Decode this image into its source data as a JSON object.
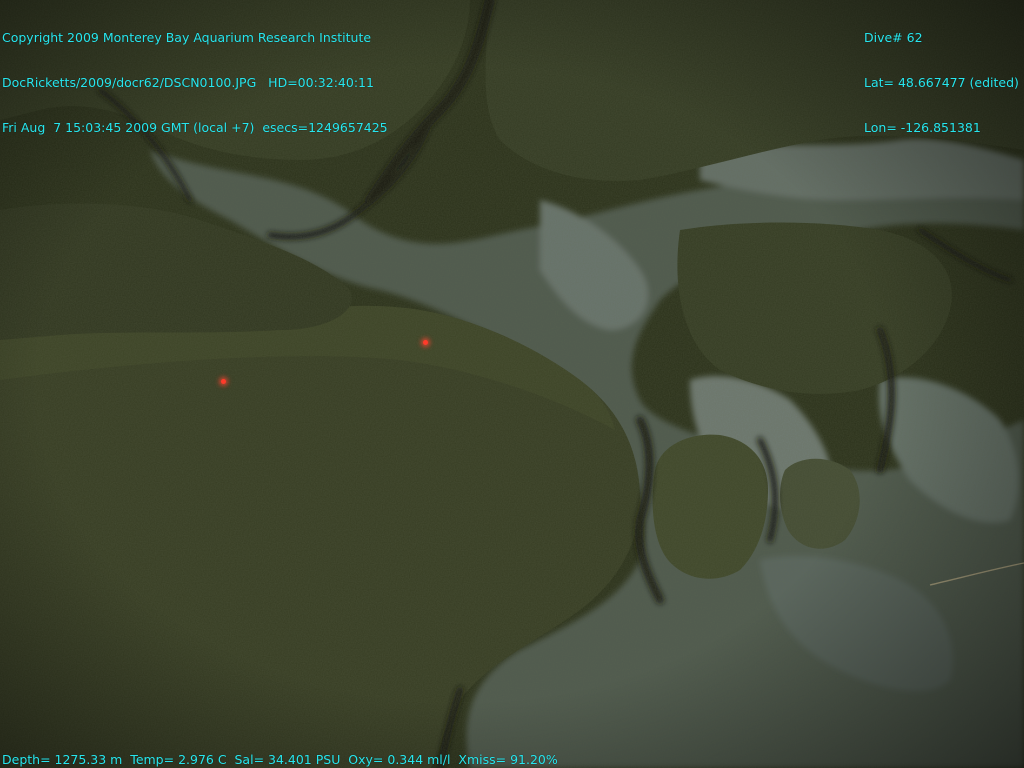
{
  "overlay": {
    "top_left": [
      "Copyright 2009 Monterey Bay Aquarium Research Institute",
      "DocRicketts/2009/docr62/DSCN0100.JPG   HD=00:32:40:11",
      "Fri Aug  7 15:03:45 2009 GMT (local +7)  esecs=1249657425"
    ],
    "top_right": [
      "Dive# 62",
      "Lat= 48.667477 (edited)",
      "Lon= -126.851381"
    ],
    "bottom": "Depth= 1275.33 m  Temp= 2.976 C  Sal= 34.401 PSU  Oxy= 0.344 ml/l  Xmiss= 91.20%"
  },
  "colors": {
    "overlay_text": "#27e6ee",
    "sediment": "#353b22",
    "rock": "#5f6e66",
    "laser": "#ff3b2a"
  }
}
